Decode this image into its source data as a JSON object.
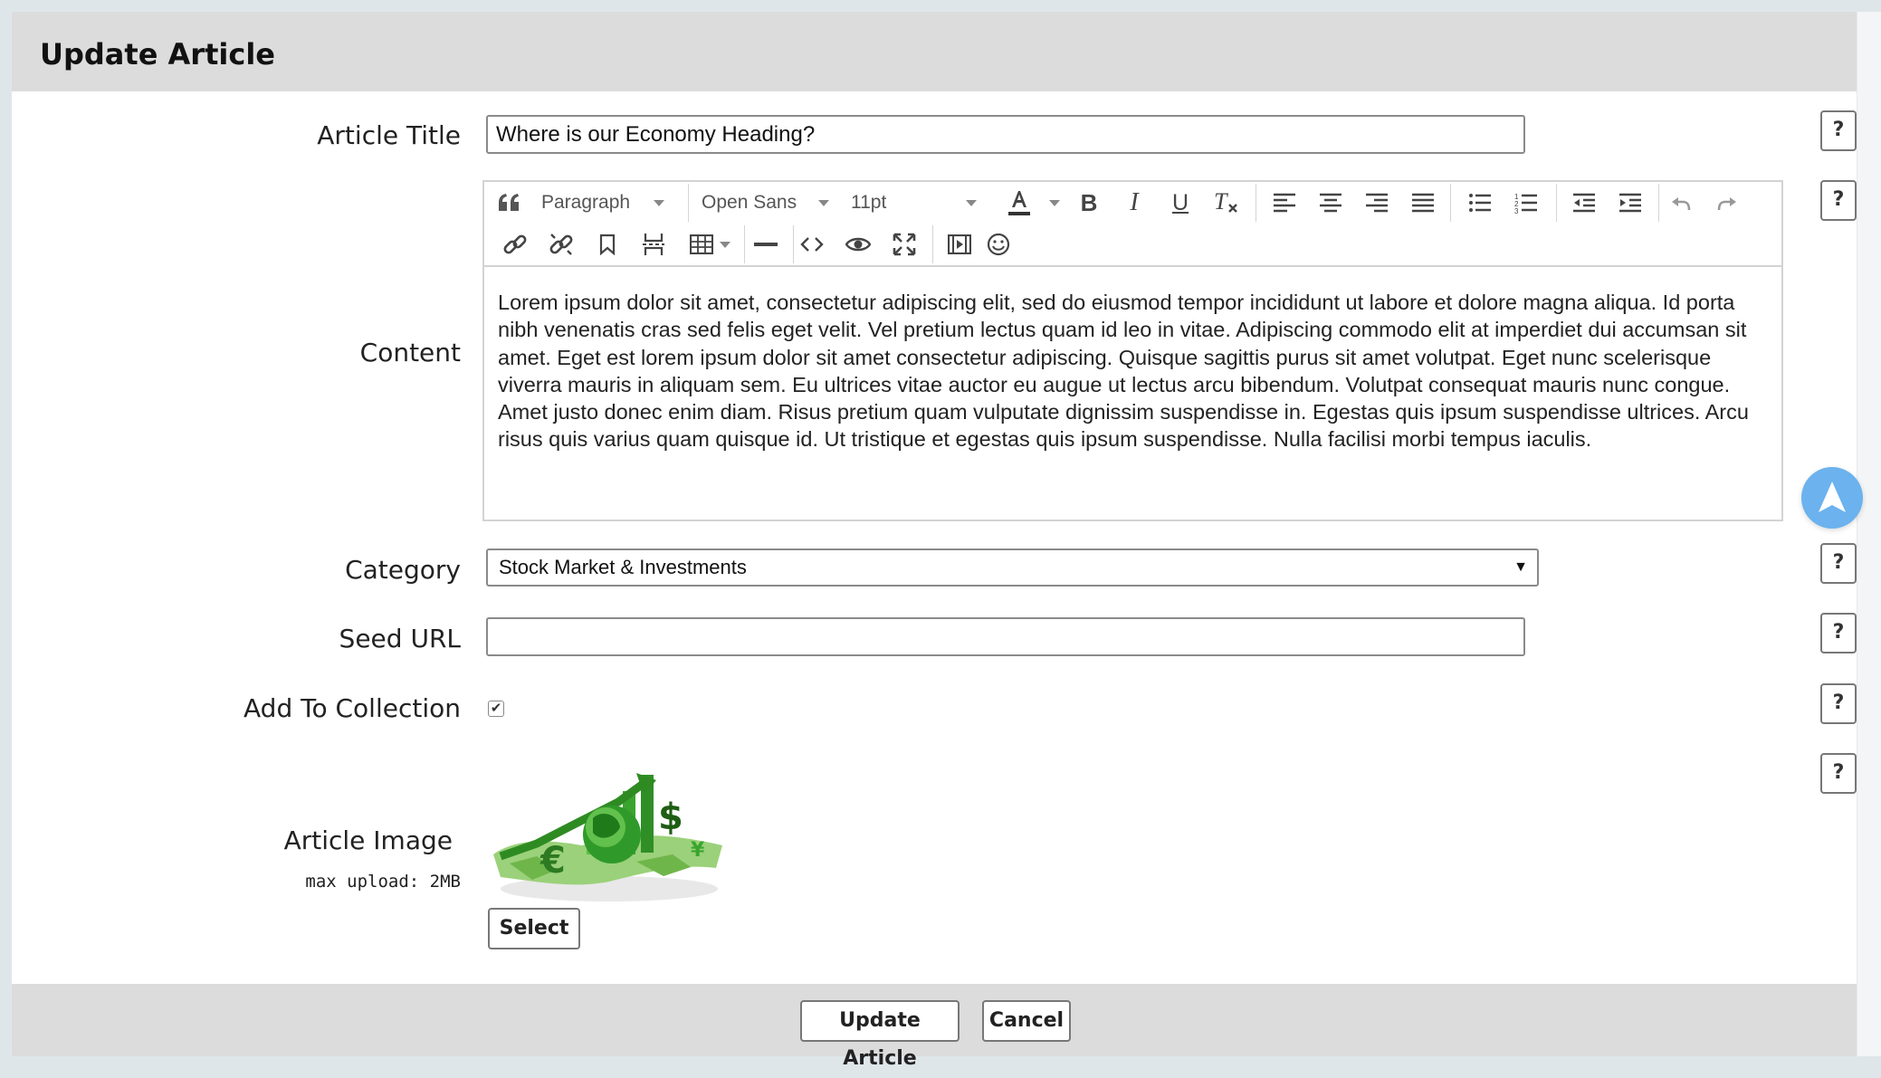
{
  "modal": {
    "title": "Update Article"
  },
  "form": {
    "article_title": {
      "label": "Article Title",
      "value": "Where is our Economy Heading?"
    },
    "content": {
      "label": "Content",
      "toolbar": {
        "block_format": "Paragraph",
        "font_family": "Open Sans",
        "font_size": "11pt"
      },
      "text": "Lorem ipsum dolor sit amet, consectetur adipiscing elit, sed do eiusmod tempor incididunt ut labore et dolore magna aliqua. Id porta nibh venenatis cras sed felis eget velit. Vel pretium lectus quam id leo in vitae. Adipiscing commodo elit at imperdiet dui accumsan sit amet. Eget est lorem ipsum dolor sit amet consectetur adipiscing. Quisque sagittis purus sit amet volutpat. Eget nunc scelerisque viverra mauris in aliquam sem. Eu ultrices vitae auctor eu augue ut lectus arcu bibendum. Volutpat consequat mauris nunc congue. Amet justo donec enim diam. Risus pretium quam vulputate dignissim suspendisse in. Egestas quis ipsum suspendisse ultrices. Arcu risus quis varius quam quisque id. Ut tristique et egestas quis ipsum suspendisse. Nulla facilisi morbi tempus iaculis."
    },
    "category": {
      "label": "Category",
      "selected": "Stock Market & Investments"
    },
    "seed_url": {
      "label": "Seed URL",
      "value": ""
    },
    "add_to_collection": {
      "label": "Add To Collection",
      "checked": true,
      "check_glyph": "✔"
    },
    "article_image": {
      "label": "Article Image",
      "hint": "max upload: 2MB",
      "select_label": "Select"
    },
    "help_label": "?"
  },
  "footer": {
    "update_label": "Update Article",
    "cancel_label": "Cancel"
  },
  "colors": {
    "header_bg": "#dcdcdc",
    "fab": "#6bb2ee",
    "image_green": "#3aa52e"
  }
}
